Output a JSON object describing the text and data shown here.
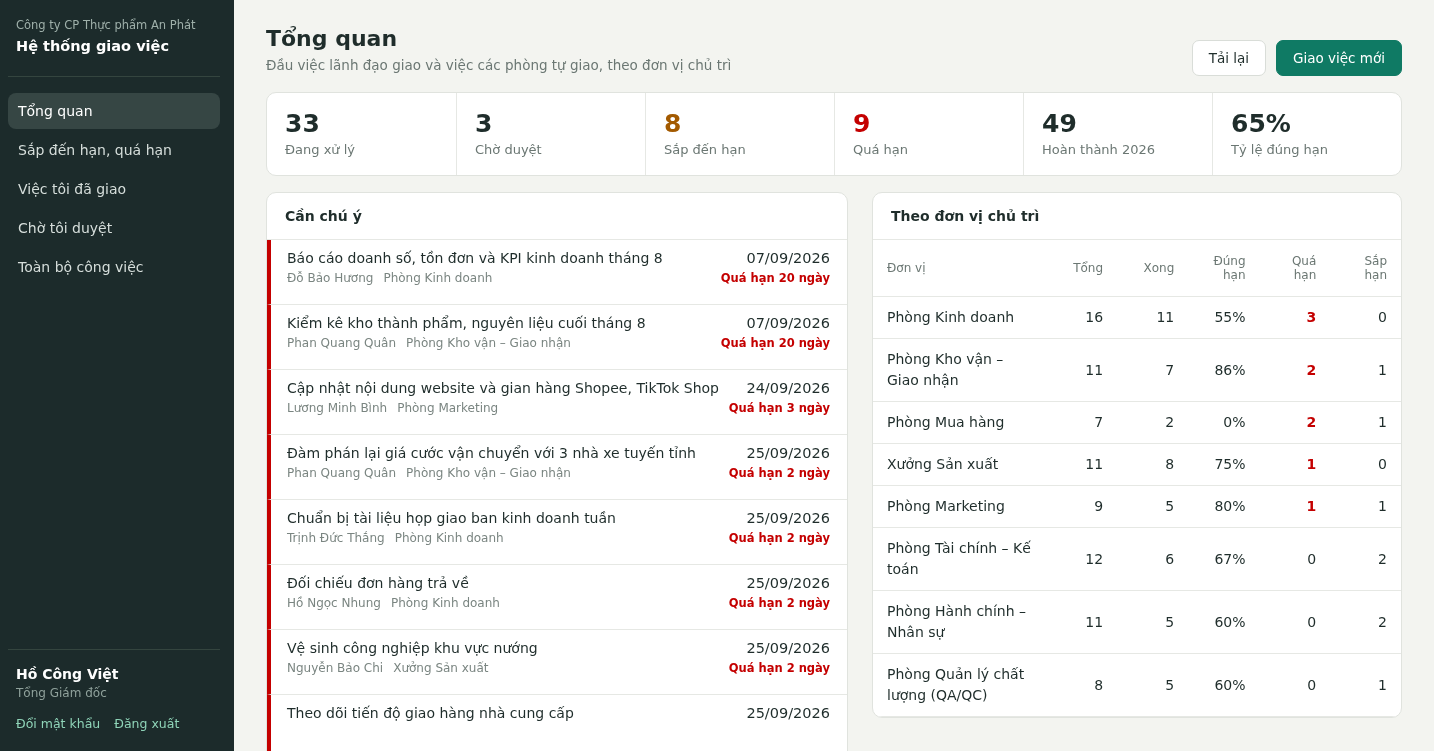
{
  "sidebar": {
    "company": "Công ty CP Thực phẩm An Phát",
    "app_title": "Hệ thống giao việc",
    "items": [
      {
        "label": "Tổng quan",
        "selected": true
      },
      {
        "label": "Sắp đến hạn, quá hạn",
        "selected": false
      },
      {
        "label": "Việc tôi đã giao",
        "selected": false
      },
      {
        "label": "Chờ tôi duyệt",
        "selected": false
      },
      {
        "label": "Toàn bộ công việc",
        "selected": false
      }
    ],
    "user": {
      "name": "Hồ Công Việt",
      "role": "Tổng Giám đốc",
      "links": [
        "Đổi mật khẩu",
        "Đăng xuất"
      ]
    }
  },
  "header": {
    "title": "Tổng quan",
    "subtitle": "Đầu việc lãnh đạo giao và việc các phòng tự giao, theo đơn vị chủ trì",
    "buttons": [
      {
        "label": "Tải lại",
        "kind": "secondary"
      },
      {
        "label": "Giao việc mới",
        "kind": "primary"
      }
    ]
  },
  "stats": [
    {
      "value": "33",
      "label": "Đang xử lý",
      "color": "#1f2d2b"
    },
    {
      "value": "3",
      "label": "Chờ duyệt",
      "color": "#1f2d2b"
    },
    {
      "value": "8",
      "label": "Sắp đến hạn",
      "color": "#a35a00"
    },
    {
      "value": "9",
      "label": "Quá hạn",
      "color": "#c40000"
    },
    {
      "value": "49",
      "label": "Hoàn thành 2026",
      "color": "#1f2d2b"
    },
    {
      "value": "65%",
      "label": "Tỷ lệ đúng hạn",
      "color": "#1f2d2b"
    }
  ],
  "attention": {
    "title": "Cần chú ý",
    "items": [
      {
        "title": "Báo cáo doanh số, tồn đơn và KPI kinh doanh tháng 8",
        "assignee": "Đỗ Bảo Hương",
        "unit": "Phòng Kinh doanh",
        "date": "07/09/2026",
        "status": "Quá hạn 20 ngày"
      },
      {
        "title": "Kiểm kê kho thành phẩm, nguyên liệu cuối tháng 8",
        "assignee": "Phan Quang Quân",
        "unit": "Phòng Kho vận – Giao nhận",
        "date": "07/09/2026",
        "status": "Quá hạn 20 ngày"
      },
      {
        "title": "Cập nhật nội dung website và gian hàng Shopee, TikTok Shop",
        "assignee": "Lương Minh Bình",
        "unit": "Phòng Marketing",
        "date": "24/09/2026",
        "status": "Quá hạn 3 ngày"
      },
      {
        "title": "Đàm phán lại giá cước vận chuyển với 3 nhà xe tuyến tỉnh",
        "assignee": "Phan Quang Quân",
        "unit": "Phòng Kho vận – Giao nhận",
        "date": "25/09/2026",
        "status": "Quá hạn 2 ngày"
      },
      {
        "title": "Chuẩn bị tài liệu họp giao ban kinh doanh tuần",
        "assignee": "Trịnh Đức Thắng",
        "unit": "Phòng Kinh doanh",
        "date": "25/09/2026",
        "status": "Quá hạn 2 ngày"
      },
      {
        "title": "Đối chiếu đơn hàng trả về",
        "assignee": "Hồ Ngọc Nhung",
        "unit": "Phòng Kinh doanh",
        "date": "25/09/2026",
        "status": "Quá hạn 2 ngày"
      },
      {
        "title": "Vệ sinh công nghiệp khu vực nướng",
        "assignee": "Nguyễn Bảo Chi",
        "unit": "Xưởng Sản xuất",
        "date": "25/09/2026",
        "status": "Quá hạn 2 ngày"
      },
      {
        "title": "Theo dõi tiến độ giao hàng nhà cung cấp",
        "date": "25/09/2026"
      }
    ]
  },
  "units": {
    "title": "Theo đơn vị chủ trì",
    "columns": [
      "Đơn vị",
      "Tổng",
      "Xong",
      "Đúng hạn",
      "Quá hạn",
      "Sắp hạn"
    ],
    "rows": [
      {
        "cells": [
          "Phòng Kinh doanh",
          "16",
          "11",
          "55%",
          "3",
          "0"
        ],
        "alert": true
      },
      {
        "cells": [
          "Phòng Kho vận – Giao nhận",
          "11",
          "7",
          "86%",
          "2",
          "1"
        ],
        "alert": true
      },
      {
        "cells": [
          "Phòng Mua hàng",
          "7",
          "2",
          "0%",
          "2",
          "1"
        ],
        "alert": true
      },
      {
        "cells": [
          "Xưởng Sản xuất",
          "11",
          "8",
          "75%",
          "1",
          "0"
        ],
        "alert": true
      },
      {
        "cells": [
          "Phòng Marketing",
          "9",
          "5",
          "80%",
          "1",
          "1"
        ],
        "alert": true
      },
      {
        "cells": [
          "Phòng Tài chính – Kế toán",
          "12",
          "6",
          "67%",
          "0",
          "2"
        ],
        "alert": false
      },
      {
        "cells": [
          "Phòng Hành chính – Nhân sự",
          "11",
          "5",
          "60%",
          "0",
          "2"
        ],
        "alert": false
      },
      {
        "cells": [
          "Phòng Quản lý chất lượng (QA/QC)",
          "8",
          "5",
          "60%",
          "0",
          "1"
        ],
        "alert": false
      }
    ]
  }
}
